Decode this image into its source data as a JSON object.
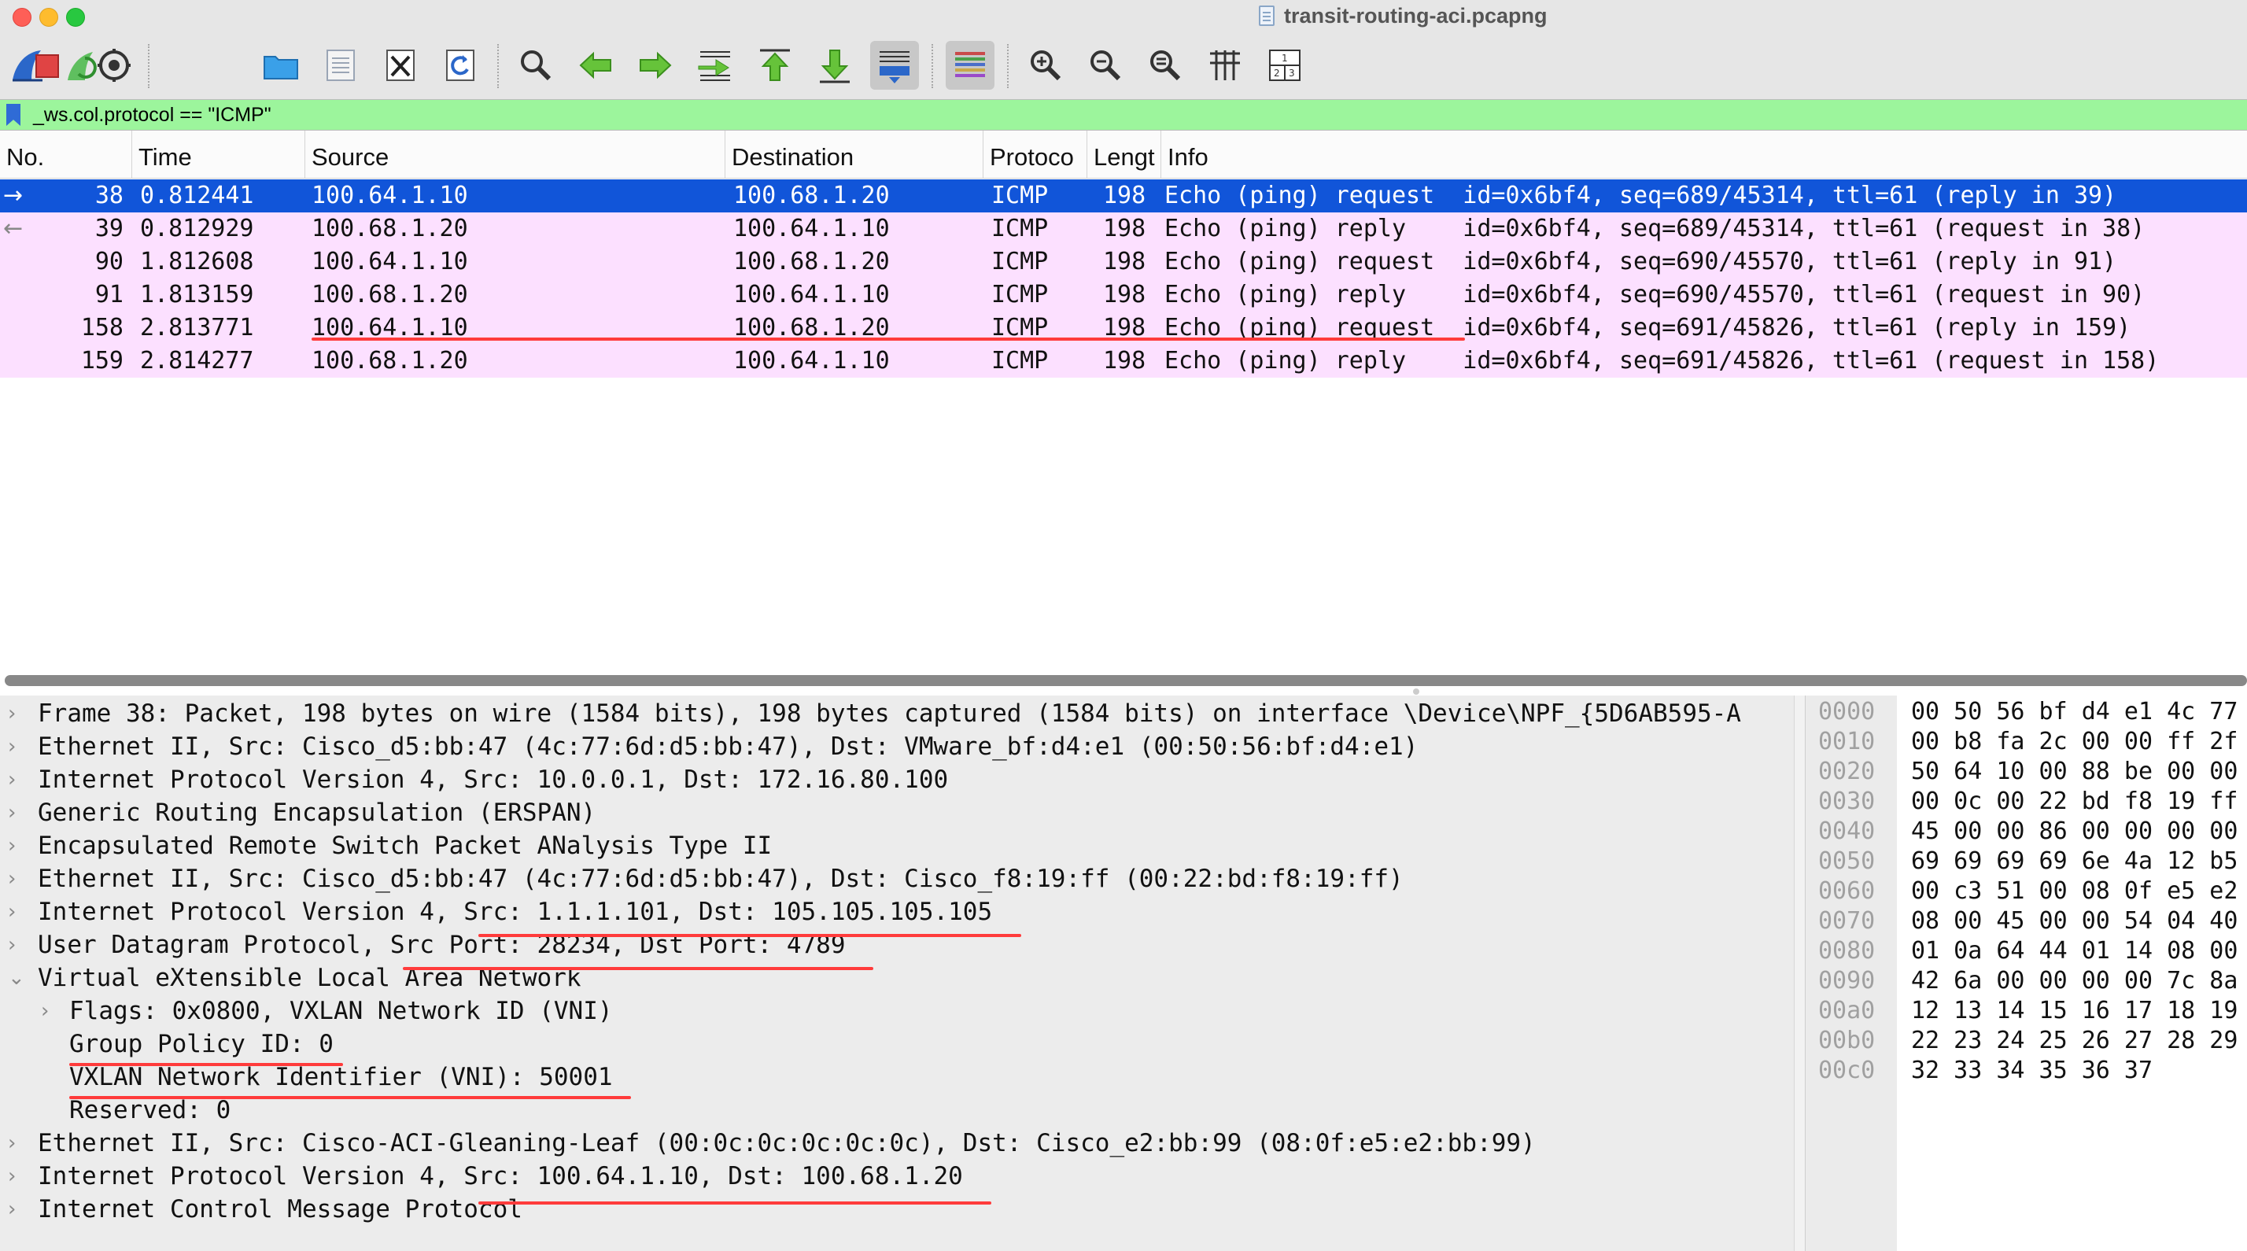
{
  "window": {
    "title": "transit-routing-aci.pcapng"
  },
  "toolbar": {
    "buttons": [
      "shark-fin-start-icon",
      "stop-capture-icon",
      "restart-capture-icon",
      "capture-options-icon",
      "open-file-icon",
      "save-file-icon",
      "close-file-icon",
      "reload-file-icon",
      "find-packet-icon",
      "go-back-icon",
      "go-forward-icon",
      "go-to-packet-icon",
      "first-packet-icon",
      "last-packet-icon",
      "autoscroll-icon",
      "colorize-icon",
      "zoom-in-icon",
      "zoom-out-icon",
      "normal-size-icon",
      "resize-columns-icon",
      "layout-icon"
    ]
  },
  "filter": {
    "value": "_ws.col.protocol == \"ICMP\""
  },
  "packet_list": {
    "columns": [
      "No.",
      "Time",
      "Source",
      "Destination",
      "Protoco",
      "Lengt",
      "Info"
    ],
    "rows": [
      {
        "no": "38",
        "time": "0.812441",
        "source": "100.64.1.10",
        "destination": "100.68.1.20",
        "protocol": "ICMP",
        "length": "198",
        "info": "Echo (ping) request  id=0x6bf4, seq=689/45314, ttl=61 (reply in 39)",
        "selected": true,
        "direction": "→"
      },
      {
        "no": "39",
        "time": "0.812929",
        "source": "100.68.1.20",
        "destination": "100.64.1.10",
        "protocol": "ICMP",
        "length": "198",
        "info": "Echo (ping) reply    id=0x6bf4, seq=689/45314, ttl=61 (request in 38)",
        "selected": false,
        "direction": "←"
      },
      {
        "no": "90",
        "time": "1.812608",
        "source": "100.64.1.10",
        "destination": "100.68.1.20",
        "protocol": "ICMP",
        "length": "198",
        "info": "Echo (ping) request  id=0x6bf4, seq=690/45570, ttl=61 (reply in 91)",
        "selected": false,
        "direction": ""
      },
      {
        "no": "91",
        "time": "1.813159",
        "source": "100.68.1.20",
        "destination": "100.64.1.10",
        "protocol": "ICMP",
        "length": "198",
        "info": "Echo (ping) reply    id=0x6bf4, seq=690/45570, ttl=61 (request in 90)",
        "selected": false,
        "direction": ""
      },
      {
        "no": "158",
        "time": "2.813771",
        "source": "100.64.1.10",
        "destination": "100.68.1.20",
        "protocol": "ICMP",
        "length": "198",
        "info": "Echo (ping) request  id=0x6bf4, seq=691/45826, ttl=61 (reply in 159)",
        "selected": false,
        "direction": ""
      },
      {
        "no": "159",
        "time": "2.814277",
        "source": "100.68.1.20",
        "destination": "100.64.1.10",
        "protocol": "ICMP",
        "length": "198",
        "info": "Echo (ping) reply    id=0x6bf4, seq=691/45826, ttl=61 (request in 158)",
        "selected": false,
        "direction": ""
      }
    ]
  },
  "details": [
    {
      "text": "Frame 38: Packet, 198 bytes on wire (1584 bits), 198 bytes captured (1584 bits) on interface \\Device\\NPF_{5D6AB595-A",
      "chev": "›",
      "indent": 0
    },
    {
      "text": "Ethernet II, Src: Cisco_d5:bb:47 (4c:77:6d:d5:bb:47), Dst: VMware_bf:d4:e1 (00:50:56:bf:d4:e1)",
      "chev": "›",
      "indent": 0
    },
    {
      "text": "Internet Protocol Version 4, Src: 10.0.0.1, Dst: 172.16.80.100",
      "chev": "›",
      "indent": 0
    },
    {
      "text": "Generic Routing Encapsulation (ERSPAN)",
      "chev": "›",
      "indent": 0
    },
    {
      "text": "Encapsulated Remote Switch Packet ANalysis Type II",
      "chev": "›",
      "indent": 0
    },
    {
      "text": "Ethernet II, Src: Cisco_d5:bb:47 (4c:77:6d:d5:bb:47), Dst: Cisco_f8:19:ff (00:22:bd:f8:19:ff)",
      "chev": "›",
      "indent": 0
    },
    {
      "text": "Internet Protocol Version 4, Src: 1.1.1.101, Dst: 105.105.105.105",
      "chev": "›",
      "indent": 0
    },
    {
      "text": "User Datagram Protocol, Src Port: 28234, Dst Port: 4789",
      "chev": "›",
      "indent": 0
    },
    {
      "text": "Virtual eXtensible Local Area Network",
      "chev": "⌄",
      "indent": 0
    },
    {
      "text": "Flags: 0x0800, VXLAN Network ID (VNI)",
      "chev": "›",
      "indent": 1
    },
    {
      "text": "Group Policy ID: 0",
      "chev": "",
      "indent": 1
    },
    {
      "text": "VXLAN Network Identifier (VNI): 50001",
      "chev": "",
      "indent": 1
    },
    {
      "text": "Reserved: 0",
      "chev": "",
      "indent": 1
    },
    {
      "text": "Ethernet II, Src: Cisco-ACI-Gleaning-Leaf (00:0c:0c:0c:0c:0c), Dst: Cisco_e2:bb:99 (08:0f:e5:e2:bb:99)",
      "chev": "›",
      "indent": 0
    },
    {
      "text": "Internet Protocol Version 4, Src: 100.64.1.10, Dst: 100.68.1.20",
      "chev": "›",
      "indent": 0
    },
    {
      "text": "Internet Control Message Protocol",
      "chev": "›",
      "indent": 0
    }
  ],
  "bytes": [
    {
      "offset": "0000",
      "hex": "00 50 56 bf d4 e1 4c 77"
    },
    {
      "offset": "0010",
      "hex": "00 b8 fa 2c 00 00 ff 2f"
    },
    {
      "offset": "0020",
      "hex": "50 64 10 00 88 be 00 00"
    },
    {
      "offset": "0030",
      "hex": "00 0c 00 22 bd f8 19 ff"
    },
    {
      "offset": "0040",
      "hex": "45 00 00 86 00 00 00 00"
    },
    {
      "offset": "0050",
      "hex": "69 69 69 69 6e 4a 12 b5"
    },
    {
      "offset": "0060",
      "hex": "00 c3 51 00 08 0f e5 e2"
    },
    {
      "offset": "0070",
      "hex": "08 00 45 00 00 54 04 40"
    },
    {
      "offset": "0080",
      "hex": "01 0a 64 44 01 14 08 00"
    },
    {
      "offset": "0090",
      "hex": "42 6a 00 00 00 00 7c 8a"
    },
    {
      "offset": "00a0",
      "hex": "12 13 14 15 16 17 18 19"
    },
    {
      "offset": "00b0",
      "hex": "22 23 24 25 26 27 28 29"
    },
    {
      "offset": "00c0",
      "hex": "32 33 34 35 36 37"
    }
  ]
}
